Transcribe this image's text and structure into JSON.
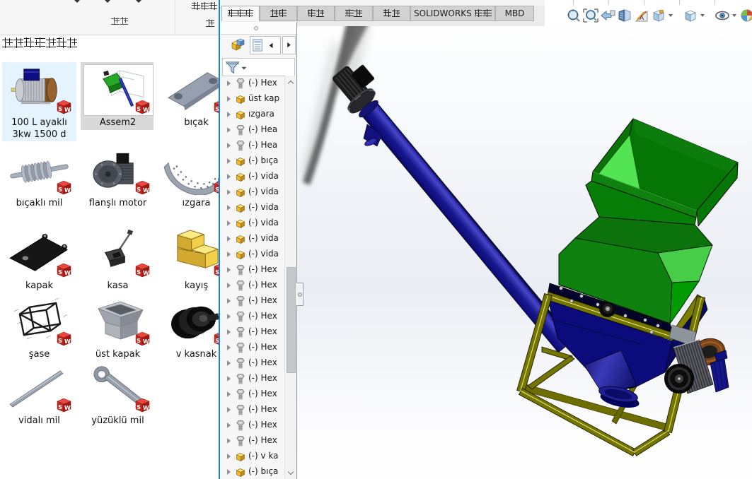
{
  "explorer": {
    "toolbar": {
      "organize": "组织",
      "folder": "文件夹",
      "new": "新"
    },
    "group_title": "破碎机三维套图",
    "items": [
      {
        "label": "100 L ayaklı",
        "label2": "3kw 1500 d",
        "thumb": "motor-100l",
        "state": "selected"
      },
      {
        "label": "Assem2",
        "thumb": "assem2",
        "state": "highlighted"
      },
      {
        "label": "bıçak",
        "thumb": "bicak",
        "state": "none"
      },
      {
        "label": "bıçaklı mil",
        "thumb": "bicakli-mil",
        "state": "none"
      },
      {
        "label": "flanşlı motor",
        "thumb": "flansli-motor",
        "state": "none"
      },
      {
        "label": "ızgara",
        "thumb": "izgara",
        "state": "none"
      },
      {
        "label": "kapak",
        "thumb": "kapak",
        "state": "none"
      },
      {
        "label": "kasa",
        "thumb": "kasa",
        "state": "none"
      },
      {
        "label": "kayış",
        "thumb": "kayis",
        "state": "none"
      },
      {
        "label": "şase",
        "thumb": "sase",
        "state": "none"
      },
      {
        "label": "üst kapak",
        "thumb": "ust-kapak",
        "state": "none"
      },
      {
        "label": "v kasnak",
        "thumb": "v-kasnak",
        "state": "none"
      },
      {
        "label": "vidalı mil",
        "thumb": "vidali-mil",
        "state": "none"
      },
      {
        "label": "yüzüklü mil",
        "thumb": "yuzuklu-mil",
        "state": "none"
      }
    ]
  },
  "commandmanager": {
    "tabs": [
      "装配体",
      "布局",
      "草图",
      "标注",
      "评估",
      "SOLIDWORKS 插件",
      "MBD"
    ],
    "active_tab": "装配体"
  },
  "feature_tree": {
    "items": [
      {
        "icon": "bolt",
        "label": "(-) Hex"
      },
      {
        "icon": "part",
        "label": "üst kap"
      },
      {
        "icon": "part",
        "label": "ızgara"
      },
      {
        "icon": "bolt",
        "label": "(-) Hea"
      },
      {
        "icon": "bolt",
        "label": "(-) Hea"
      },
      {
        "icon": "part",
        "label": "(-) bıça"
      },
      {
        "icon": "part",
        "label": "(-) vida"
      },
      {
        "icon": "part",
        "label": "(-) vida"
      },
      {
        "icon": "part",
        "label": "(-) vida"
      },
      {
        "icon": "part",
        "label": "(-) vida"
      },
      {
        "icon": "part",
        "label": "(-) vida"
      },
      {
        "icon": "part",
        "label": "(-) vida"
      },
      {
        "icon": "bolt",
        "label": "(-) Hex"
      },
      {
        "icon": "bolt",
        "label": "(-) Hex"
      },
      {
        "icon": "bolt",
        "label": "(-) Hex"
      },
      {
        "icon": "bolt",
        "label": "(-) Hex"
      },
      {
        "icon": "bolt",
        "label": "(-) Hex"
      },
      {
        "icon": "bolt",
        "label": "(-) Hex"
      },
      {
        "icon": "bolt",
        "label": "(-) Hex"
      },
      {
        "icon": "bolt",
        "label": "(-) Hex"
      },
      {
        "icon": "bolt",
        "label": "(-) Hex"
      },
      {
        "icon": "bolt",
        "label": "(-) Hex"
      },
      {
        "icon": "bolt",
        "label": "(-) Hex"
      },
      {
        "icon": "bolt",
        "label": "(-) Hex"
      },
      {
        "icon": "part",
        "label": "(-) v ka"
      },
      {
        "icon": "part",
        "label": "(-) bıça"
      }
    ]
  },
  "view_toolbar": {
    "icons": [
      {
        "name": "zoom-fit"
      },
      {
        "name": "zoom-to-area"
      },
      {
        "name": "previous-view"
      },
      {
        "name": "section-view"
      },
      {
        "name": "annotations"
      },
      {
        "name": "view-orientation",
        "dropdown": true
      },
      {
        "name": "display-style",
        "dropdown": true
      },
      {
        "name": "hide-show-items",
        "dropdown": true
      },
      {
        "name": "edit-appearance"
      }
    ]
  },
  "model": {
    "description": "crusher assembly with screw conveyor",
    "colors": {
      "hopper_green": "#0e810e",
      "hopper_green_light": "#52e452",
      "hopper_green_dark": "#077e07",
      "housing_green_light": "#48cd48",
      "housing_green_bright": "#019c01",
      "body_navy": "#04042a",
      "funnel_blue": "#0b0b7c",
      "tube_blue": "#18188e",
      "frame_yellow": "#747400",
      "frame_yellow_highlight": "#eeee7b",
      "motor_copper": "#7a431a"
    }
  }
}
